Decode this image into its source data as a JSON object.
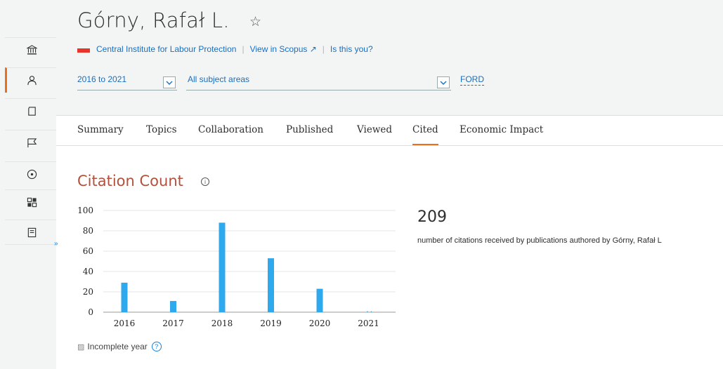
{
  "rail": {
    "items": [
      {
        "icon": "institution-icon"
      },
      {
        "icon": "person-icon",
        "active": true
      },
      {
        "icon": "document-icon"
      },
      {
        "icon": "flag-icon"
      },
      {
        "icon": "target-icon"
      },
      {
        "icon": "dashboard-icon"
      },
      {
        "icon": "report-icon"
      }
    ],
    "toggle_label": "»"
  },
  "author": {
    "name": "Górny, Rafał L.",
    "favorite_icon": "☆"
  },
  "links": {
    "institution": "Central Institute for Labour Protection",
    "scopus": "View in Scopus ↗",
    "claim": "Is this you?"
  },
  "filters": {
    "year_range": "2016 to 2021",
    "subject": "All subject areas",
    "ford": "FORD"
  },
  "tabs": [
    {
      "label": "Summary"
    },
    {
      "label": "Topics"
    },
    {
      "label": "Collaboration"
    },
    {
      "label": "Published"
    },
    {
      "label": "Viewed"
    },
    {
      "label": "Cited",
      "active": true
    },
    {
      "label": "Economic Impact"
    }
  ],
  "section": {
    "title": "Citation Count",
    "info_icon": "ⓘ"
  },
  "summary": {
    "total": "209",
    "description": "number of citations received by publications authored by Górny, Rafał L"
  },
  "legend": {
    "incomplete_label": "Incomplete year",
    "hatch_symbol": "▨",
    "help_icon": "?"
  },
  "colors": {
    "accent": "#e9711c",
    "bar": "#2fa9ee",
    "title": "#b3513d",
    "link": "#1a6fbf"
  },
  "chart_data": {
    "type": "bar",
    "categories": [
      "2016",
      "2017",
      "2018",
      "2019",
      "2020",
      "2021"
    ],
    "values": [
      29,
      11,
      88,
      53,
      23,
      1
    ],
    "incomplete": [
      false,
      false,
      false,
      false,
      false,
      true
    ],
    "title": "",
    "xlabel": "",
    "ylabel": "",
    "ylim": [
      0,
      100
    ],
    "yticks": [
      0,
      20,
      40,
      60,
      80,
      100
    ],
    "grid": true
  }
}
